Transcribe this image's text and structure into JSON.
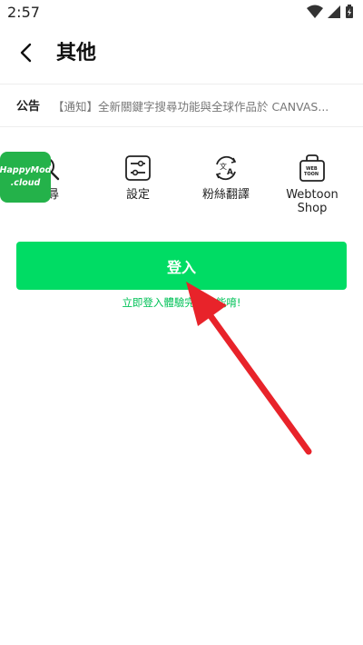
{
  "status_bar": {
    "time": "2:57"
  },
  "header": {
    "title": "其他"
  },
  "notice": {
    "label": "公告",
    "text": "【通知】全新關鍵字搜尋功能與全球作品於 CANVAS..."
  },
  "shortcuts": [
    {
      "label": "搜尋",
      "icon": "search-icon"
    },
    {
      "label": "設定",
      "icon": "settings-icon"
    },
    {
      "label": "粉絲翻譯",
      "icon": "translate-icon"
    },
    {
      "label": "Webtoon Shop",
      "icon": "shop-bag-icon"
    }
  ],
  "watermark": {
    "line1": "HappyMod",
    "line2": ".cloud"
  },
  "login": {
    "button_label": "登入",
    "subtext": "立即登入體驗完整功能唷!"
  },
  "colors": {
    "accent": "#00dc64",
    "accent_text": "#00c257",
    "annotation_arrow": "#e8232a"
  }
}
